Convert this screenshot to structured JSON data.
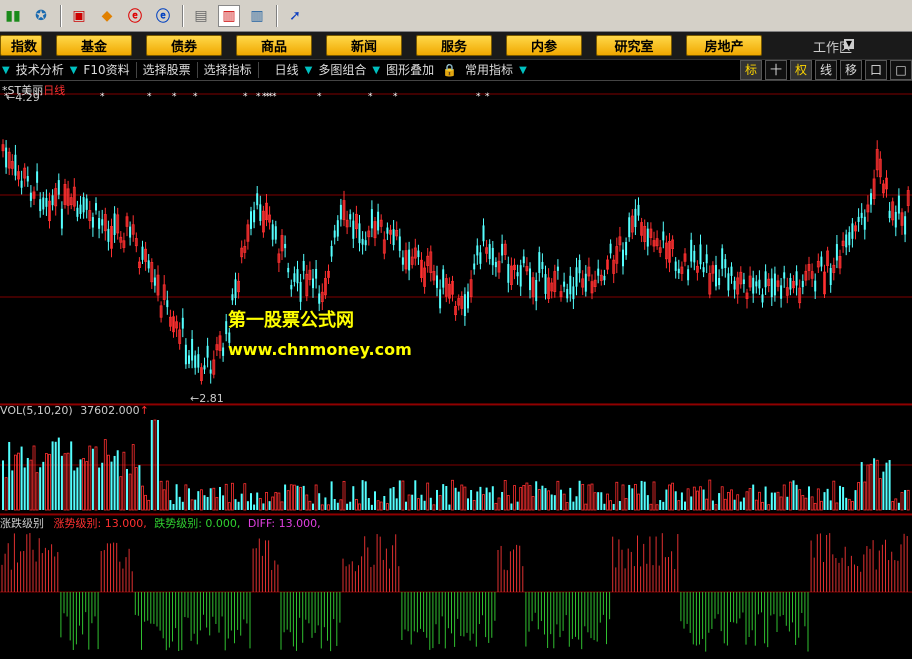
{
  "toolbar": {
    "icons": [
      "chart-bars-icon",
      "bell-icon",
      "monitor-icon",
      "diamond-icon",
      "red-e-icon",
      "blue-e-icon",
      "notebook-icon",
      "window-icon",
      "books-icon",
      "help-cursor-icon"
    ]
  },
  "menu": {
    "items": [
      "指数",
      "基金",
      "债券",
      "商品",
      "新闻",
      "服务",
      "内参",
      "研究室",
      "房地产"
    ],
    "workspace": "工作区"
  },
  "subbar": {
    "items": [
      "技术分析",
      "F10资料",
      "选择股票",
      "选择指标",
      "日线",
      "多图组合",
      "图形叠加",
      "常用指标"
    ],
    "right_buttons": [
      "标",
      "十",
      "权",
      "线",
      "移",
      "口",
      "□"
    ]
  },
  "chart": {
    "stock_name": "*ST美丽",
    "period": "日线",
    "high_marker": "4.29",
    "low_marker": "2.81",
    "vol_label": "VOL(5,10,20)",
    "vol_value": "37602.000",
    "indicator_name": "涨跌级别",
    "indicator_rise_label": "涨势级别: 13.000,",
    "indicator_fall_label": "跌势级别: 0.000,",
    "indicator_diff_label": "DIFF: 13.000,"
  },
  "watermark": {
    "line1": "第一股票公式网",
    "line2": "www.chnmoney.com"
  },
  "colors": {
    "up": "#ff3030",
    "down": "#54ffff",
    "indicator_up": "#e03030",
    "indicator_down": "#30c030",
    "grid": "#800000"
  }
}
